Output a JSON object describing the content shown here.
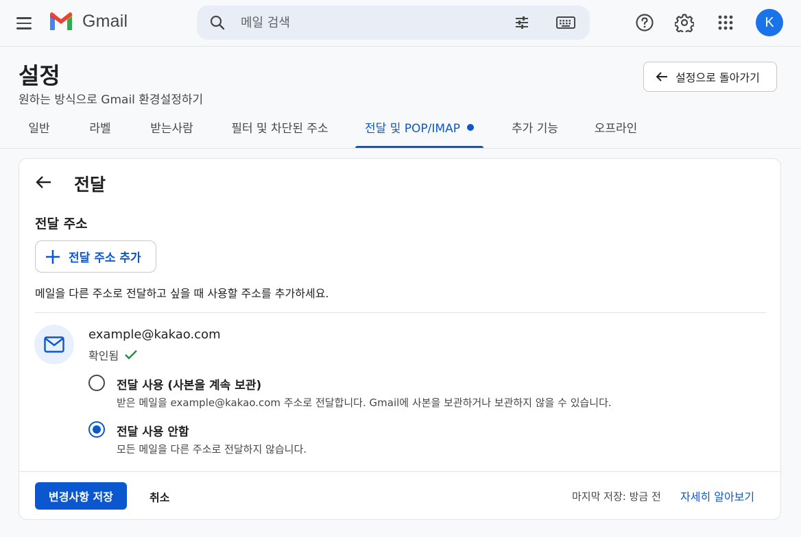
{
  "header": {
    "logo_text": "Gmail",
    "search_placeholder": "메일 검색",
    "avatar_letter": "K"
  },
  "settings": {
    "title": "설정",
    "subtitle": "원하는 방식으로 Gmail 환경설정하기",
    "back_label": "설정으로 돌아가기",
    "tabs": [
      {
        "label": "일반",
        "active": false
      },
      {
        "label": "라벨",
        "active": false
      },
      {
        "label": "받는사람",
        "active": false
      },
      {
        "label": "필터 및 차단된 주소",
        "active": false
      },
      {
        "label": "전달 및 POP/IMAP",
        "active": true
      },
      {
        "label": "추가 기능",
        "active": false
      },
      {
        "label": "오프라인",
        "active": false
      }
    ]
  },
  "forwarding": {
    "title": "전달",
    "section_title": "전달 주소",
    "add_button_label": "전달 주소 추가",
    "helper_text": "메일을 다른 주소로 전달하고 싶을 때 사용할 주소를 추가하세요.",
    "address": {
      "email": "example@kakao.com",
      "status": "확인됨"
    },
    "options": [
      {
        "label": "전달 사용 (사본을 계속 보관)",
        "description": "받은 메일을 example@kakao.com 주소로 전달합니다. Gmail에 사본을 보관하거나 보관하지 않을 수 있습니다.",
        "selected": false
      },
      {
        "label": "전달 사용 안함",
        "description": "모든 메일을 다른 주소로 전달하지 않습니다.",
        "selected": true
      }
    ]
  },
  "footer": {
    "save_label": "변경사항 저장",
    "cancel_label": "취소",
    "last_saved": "마지막 저장: 방금 전",
    "learn_more": "자세히 알아보기"
  },
  "colors": {
    "accent": "#0b57d0",
    "avatar": "#1a73e8",
    "verified": "#1e8e3e"
  }
}
